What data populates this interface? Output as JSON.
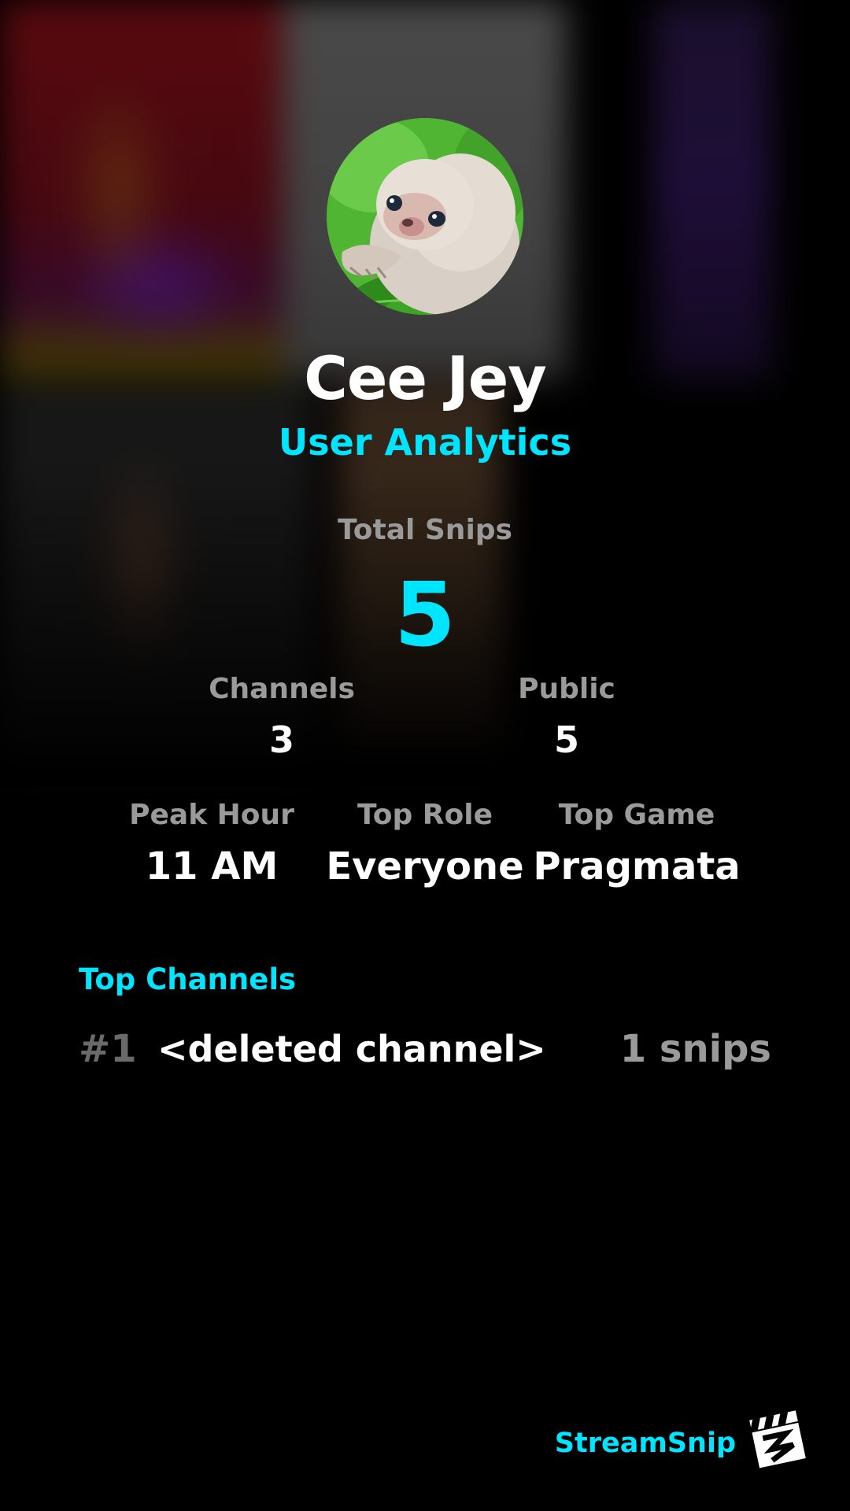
{
  "profile": {
    "username": "Cee Jey",
    "subtitle": "User Analytics",
    "avatar_icon": "sloth-avatar"
  },
  "stats": {
    "total_snips": {
      "label": "Total Snips",
      "value": "5"
    },
    "channels": {
      "label": "Channels",
      "value": "3"
    },
    "public": {
      "label": "Public",
      "value": "5"
    },
    "peak_hour": {
      "label": "Peak Hour",
      "value": "11 AM"
    },
    "top_role": {
      "label": "Top Role",
      "value": "Everyone"
    },
    "top_game": {
      "label": "Top Game",
      "value": "Pragmata"
    }
  },
  "top_channels": {
    "title": "Top Channels",
    "items": [
      {
        "rank": "#1",
        "name": "<deleted channel>",
        "count": "1 snips"
      }
    ]
  },
  "branding": {
    "name": "StreamSnip",
    "logo_icon": "clapperboard-logo-icon"
  },
  "colors": {
    "accent": "#00e5ff",
    "background": "#000000",
    "label": "#9a9a9a",
    "rank": "#6a6a6a",
    "text": "#ffffff"
  }
}
